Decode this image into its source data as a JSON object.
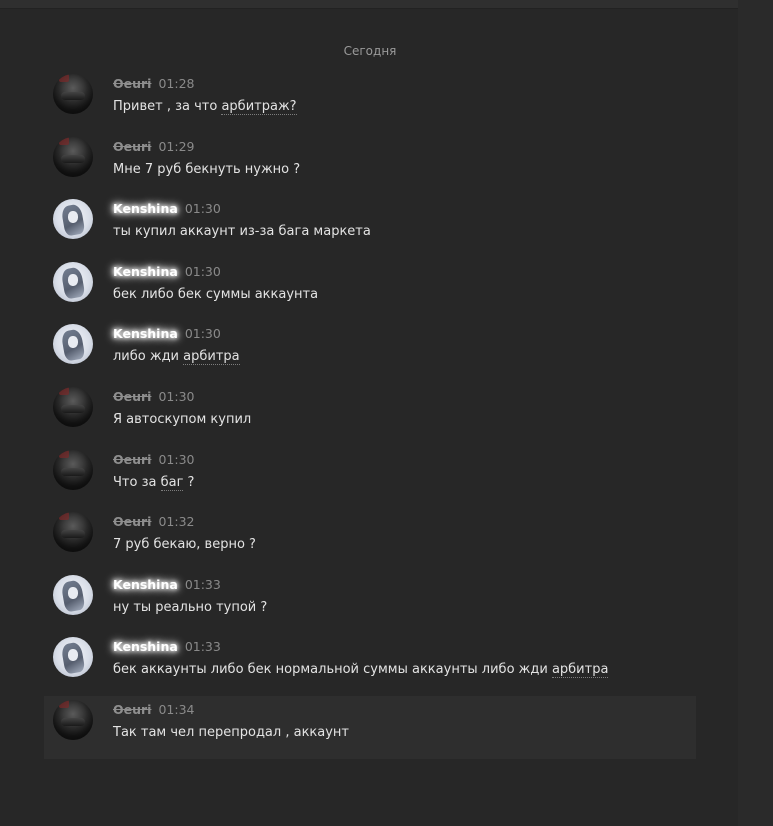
{
  "chat": {
    "date_divider": "Сегодня",
    "messages": [
      {
        "author": "Oeuri",
        "author_style": "strike",
        "avatar": "dark-avatar",
        "time": "01:28",
        "text_before": "Привет , за что ",
        "link": "арбитраж?",
        "text_after": ""
      },
      {
        "author": "Oeuri",
        "author_style": "strike",
        "avatar": "dark-avatar",
        "time": "01:29",
        "text_before": "Мне 7 руб бекнуть нужно ?",
        "link": "",
        "text_after": ""
      },
      {
        "author": "Kenshina",
        "author_style": "glow",
        "avatar": "anime-avatar",
        "time": "01:30",
        "text_before": "ты купил аккаунт из-за бага маркета",
        "link": "",
        "text_after": ""
      },
      {
        "author": "Kenshina",
        "author_style": "glow",
        "avatar": "anime-avatar",
        "time": "01:30",
        "text_before": "бек либо бек суммы аккаунта",
        "link": "",
        "text_after": ""
      },
      {
        "author": "Kenshina",
        "author_style": "glow",
        "avatar": "anime-avatar",
        "time": "01:30",
        "text_before": "либо жди ",
        "link": "арбитра",
        "text_after": ""
      },
      {
        "author": "Oeuri",
        "author_style": "strike",
        "avatar": "dark-avatar",
        "time": "01:30",
        "text_before": "Я автоскупом купил",
        "link": "",
        "text_after": ""
      },
      {
        "author": "Oeuri",
        "author_style": "strike",
        "avatar": "dark-avatar",
        "time": "01:30",
        "text_before": "Что за ",
        "link": "баг",
        "text_after": " ?"
      },
      {
        "author": "Oeuri",
        "author_style": "strike",
        "avatar": "dark-avatar",
        "time": "01:32",
        "text_before": "7 руб бекаю, верно ?",
        "link": "",
        "text_after": ""
      },
      {
        "author": "Kenshina",
        "author_style": "glow",
        "avatar": "anime-avatar",
        "time": "01:33",
        "text_before": "ну ты реально тупой ?",
        "link": "",
        "text_after": ""
      },
      {
        "author": "Kenshina",
        "author_style": "glow",
        "avatar": "anime-avatar",
        "time": "01:33",
        "text_before": "бек аккаунты либо бек нормальной суммы аккаунты либо жди ",
        "link": "арбитра",
        "text_after": ""
      },
      {
        "author": "Oeuri",
        "author_style": "strike",
        "avatar": "dark-avatar",
        "time": "01:34",
        "text_before": "Так там чел перепродал , аккаунт",
        "link": "",
        "text_after": "",
        "highlighted": true
      }
    ]
  },
  "colors": {
    "background": "#272727",
    "highlight_row": "#2e2e2e",
    "message_text": "#e3e3e3",
    "timestamp": "#8a8a8a",
    "struck_name": "#8e8e8e",
    "glow_name": "#ffffff"
  }
}
